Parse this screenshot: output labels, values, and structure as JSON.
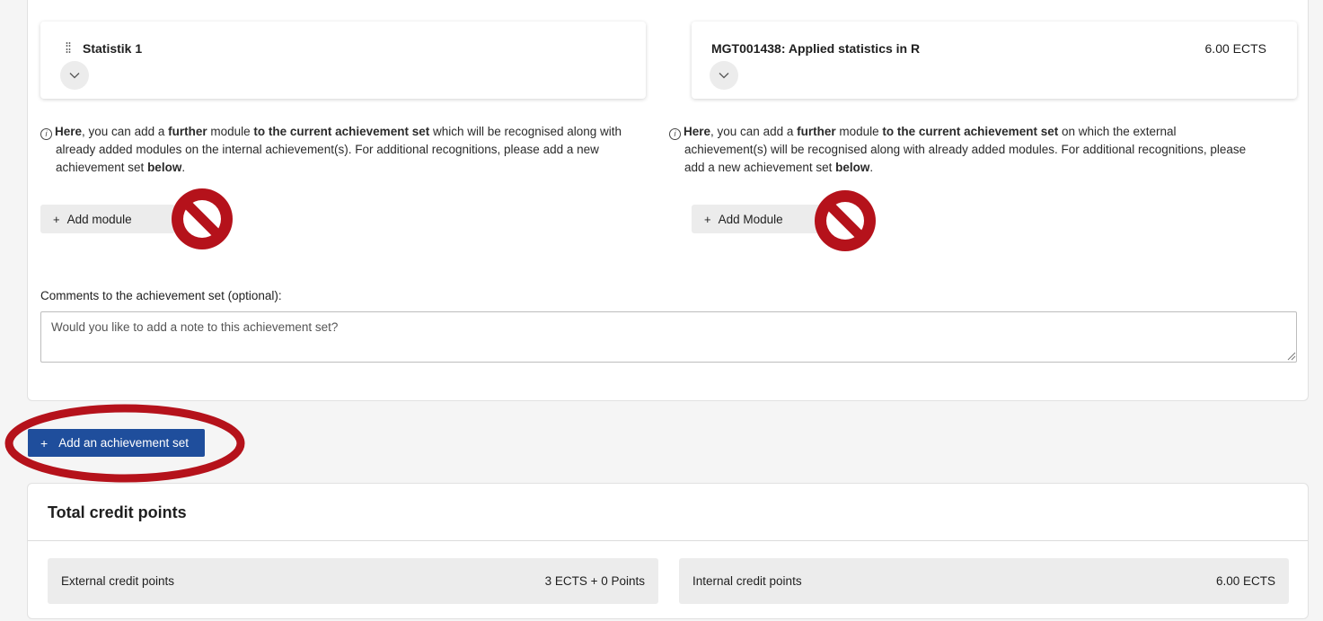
{
  "internal_module": {
    "title": "Statistik 1"
  },
  "external_module": {
    "title": "MGT001438: Applied statistics in R",
    "ects": "6.00 ECTS"
  },
  "info_left": {
    "p1": "Here",
    "p2": ", you can add a ",
    "p3": "further",
    "p4": " module ",
    "p5": "to the current achievement set",
    "p6": " which will be recognised along with",
    "line2": "already added modules on the internal achievement(s). For additional recognitions, please add a new",
    "line3a": "achievement set ",
    "line3b": "below",
    "line3c": "."
  },
  "info_right": {
    "p1": "Here",
    "p2": ", you can add a ",
    "p3": "further",
    "p4": " module ",
    "p5": "to the current achievement set",
    "p6": " on which the external",
    "line2": "achievement(s) will be recognised along with already added modules. For additional recognitions, please",
    "line3a": "add a new achievement set ",
    "line3b": "below",
    "line3c": "."
  },
  "buttons": {
    "plus": "+",
    "add_module_left": "Add module",
    "add_module_right": "Add Module",
    "add_set": "Add an achievement set"
  },
  "comments": {
    "label": "Comments to the achievement set (optional):",
    "placeholder": "Would you like to add a note to this achievement set?",
    "value": ""
  },
  "totals": {
    "title": "Total credit points",
    "external_label": "External credit points",
    "external_value": "3 ECTS + 0 Points",
    "internal_label": "Internal credit points",
    "internal_value": "6.00 ECTS"
  },
  "annotation_colors": {
    "no_sign": "#b5121b",
    "ellipse": "#b5121b",
    "primary_button": "#1f4e9c"
  },
  "icons": {
    "drag": "drag-handle-icon",
    "chevron": "chevron-down-icon",
    "info": "info-icon",
    "no_sign": "prohibited-icon"
  }
}
